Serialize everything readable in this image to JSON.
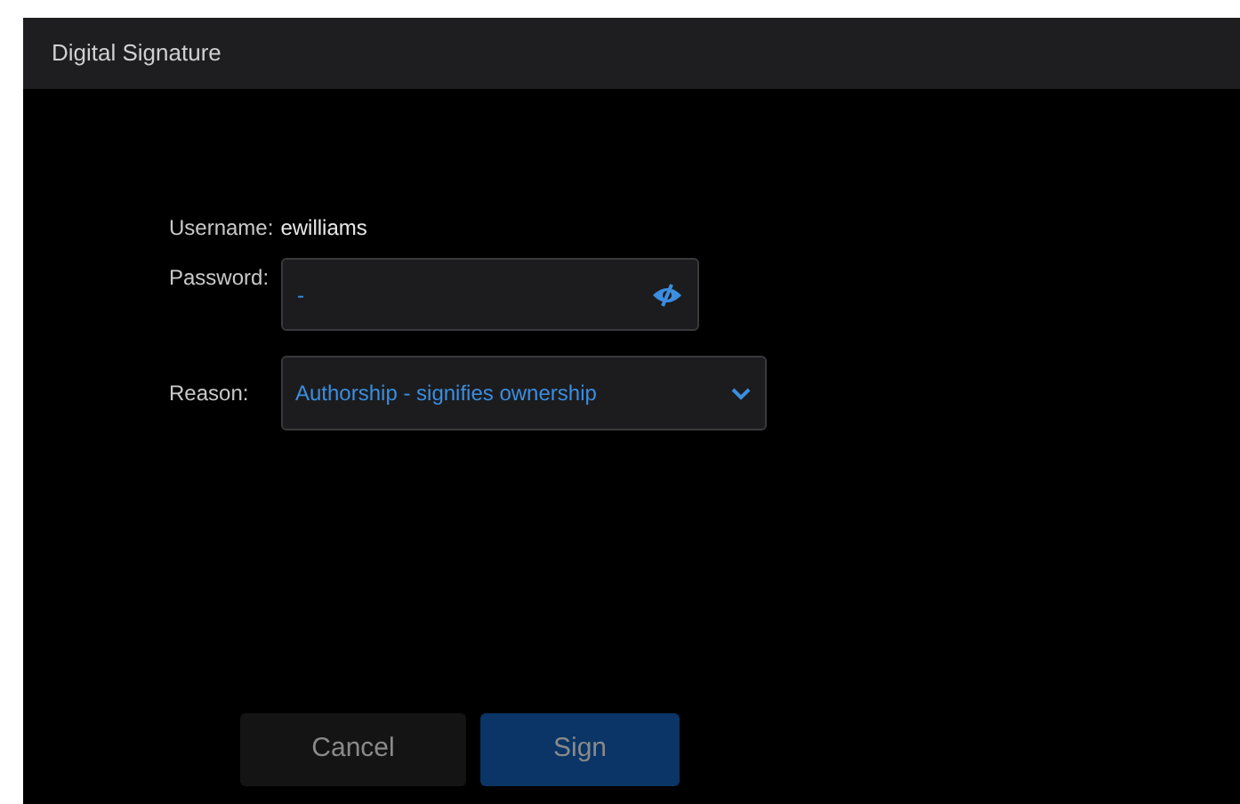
{
  "window": {
    "title": "Digital Signature"
  },
  "username": {
    "label": "Username:",
    "value": "ewilliams"
  },
  "password": {
    "label": "Password:",
    "value": "-"
  },
  "reason": {
    "label": "Reason:",
    "value": "Authorship - signifies ownership"
  },
  "buttons": [
    {
      "label": "Cancel",
      "kind": "secondary"
    },
    {
      "label": "Sign",
      "kind": "primary"
    }
  ]
}
